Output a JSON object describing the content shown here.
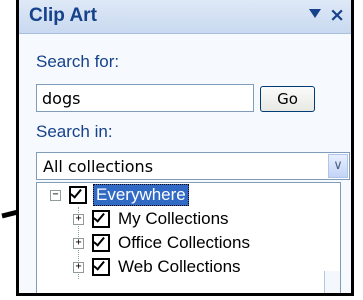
{
  "pane": {
    "title": "Clip Art",
    "search_label": "Search for:",
    "search_value": "dogs",
    "go_label": "Go",
    "search_in_label": "Search in:",
    "collection_selected": "All collections"
  },
  "tree": {
    "root_label": "Everywhere",
    "children": [
      {
        "label": "My Collections"
      },
      {
        "label": "Office Collections"
      },
      {
        "label": "Web Collections"
      }
    ]
  }
}
